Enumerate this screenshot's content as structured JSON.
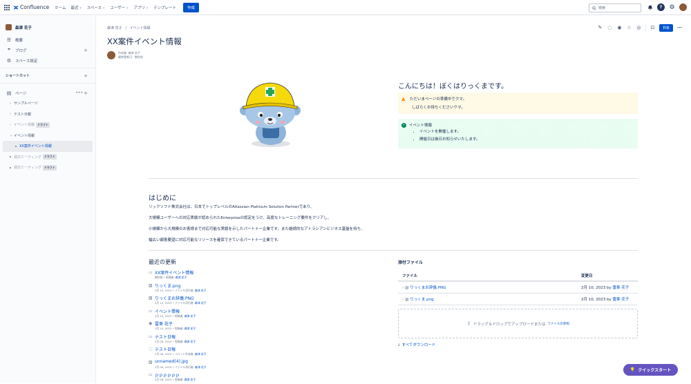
{
  "topnav": {
    "product": "Confluence",
    "items": [
      {
        "label": "ホーム",
        "chevron": false
      },
      {
        "label": "最近",
        "chevron": true
      },
      {
        "label": "スペース",
        "chevron": true
      },
      {
        "label": "ユーザー",
        "chevron": true
      },
      {
        "label": "アプリ",
        "chevron": true
      },
      {
        "label": "テンプレート",
        "chevron": false
      }
    ],
    "create_label": "作成",
    "search_placeholder": "検索"
  },
  "sidebar": {
    "space_name": "森津 花子",
    "nav": [
      {
        "label": "概要",
        "icon": "overview-icon"
      },
      {
        "label": "ブログ",
        "icon": "quote-icon"
      },
      {
        "label": "スペース設定",
        "icon": "gear-icon"
      }
    ],
    "shortcut_label": "ショートカット",
    "pages_label": "ページ",
    "tree": [
      {
        "label": "サンプルページ",
        "level": 1,
        "twisty": "›",
        "draft": "",
        "muted": false,
        "active": false
      },
      {
        "label": "テスト日報",
        "level": 1,
        "twisty": "›",
        "draft": "",
        "muted": false,
        "active": false
      },
      {
        "label": "イベント情報",
        "level": 1,
        "twisty": "›",
        "draft": "ドラフト",
        "muted": true,
        "active": false
      },
      {
        "label": "イベント情報",
        "level": 1,
        "twisty": "⌄",
        "draft": "",
        "muted": false,
        "active": false
      },
      {
        "label": "XX案件イベント情報",
        "level": 2,
        "twisty": "",
        "draft": "",
        "muted": false,
        "active": true
      },
      {
        "label": "週次ミーティング",
        "level": 1,
        "twisty": "",
        "draft": "ドラフト",
        "muted": true,
        "active": false
      },
      {
        "label": "週次ミーティング",
        "level": 1,
        "twisty": "",
        "draft": "ドラフト",
        "muted": true,
        "active": false
      }
    ]
  },
  "page": {
    "breadcrumb": [
      "森津 花子",
      "イベント情報"
    ],
    "share_label": "共有",
    "title": "XX案件イベント情報",
    "byline_author": "作成者: 森津 花子",
    "byline_updated": "最終更新日：数秒前"
  },
  "hello": {
    "heading": "こんにちは！ぼくはりっくまです。",
    "note_line1": "ただいまページの準備中でクマ。",
    "note_line2": "しばらくお待ちくださいクマ。",
    "info_title": "イベント情報",
    "info_bullets": [
      "イベントを開催します。",
      "開催日は後日お知らせいたします。"
    ]
  },
  "intro": {
    "heading": "はじめに",
    "lines": [
      "リックソフト株式会社は、日本でトップレベルのAtlassian Platinum Solution Partnerであり、",
      "大規模ユーザーへの対応実績が認められたEnterpriseの認定をうけ、高度なトレーニング要件をクリアし、",
      "小規模から大規模のお客様まで対応可能な実績を示したパートナー企業です。また継続的なアトラシアンビジネス基盤を持ち、",
      "幅広い顧客要望に対応可能なリソースを確保できているパートナー企業です。"
    ]
  },
  "recent": {
    "heading": "最近の更新",
    "items": [
      {
        "icon": "page-icon",
        "title": "XX案件イベント情報",
        "meta": "数秒前 • 投稿者: ",
        "by": "森津 花子"
      },
      {
        "icon": "image-icon",
        "title": "りっくま.png",
        "meta": "2月 10, 2023 • ファイル添付者: ",
        "by": "森津 花子"
      },
      {
        "icon": "image-icon",
        "title": "りっくまお辞儀.PNG",
        "meta": "2月 10, 2023 • ファイル添付者: ",
        "by": "森津 花子"
      },
      {
        "icon": "page-icon",
        "title": "イベント情報",
        "meta": "2月 10, 2023 • 投稿者: ",
        "by": "森津 花子"
      },
      {
        "icon": "user-icon",
        "title": "雷車 花子",
        "meta": "2月 10, 2023 • 投稿者: ",
        "by": "森津 花子"
      },
      {
        "icon": "page-icon",
        "title": "テスト日報",
        "meta": "2月 06, 2023 • 投稿者: ",
        "by": "森津 花子"
      },
      {
        "icon": "comment-icon",
        "title": "テスト日報",
        "meta": "2月 06, 2023 • コメント作成者: ",
        "by": "森津 花子"
      },
      {
        "icon": "image-icon",
        "title": "unnamed(4).jpg",
        "meta": "2月 06, 2023 • ファイル添付者: ",
        "by": "森津 花子"
      },
      {
        "icon": "page-icon",
        "title": "ｐｐｐｐｐｐ",
        "meta": "2月 06, 2023 • 投稿者: ",
        "by": "森津 花子"
      }
    ]
  },
  "attachments": {
    "heading": "添付ファイル",
    "col_file": "ファイル",
    "col_modified": "変更日",
    "rows": [
      {
        "file": "りっくまお辞儀.PNG",
        "date": "2月 10, 2023 by ",
        "by": "雷車 花子"
      },
      {
        "file": "りっくま.png",
        "date": "2月 10, 2023 by ",
        "by": "雷車 花子"
      }
    ],
    "drop_text": "ドラッグ＆ドロップでアップロードまたは",
    "drop_link": "ファイルの参照",
    "download_all": "すべてダウンロード"
  },
  "quickstart_label": "クイックスタート",
  "colors": {
    "brand": "#0052cc",
    "quickstart": "#6554c0",
    "note_bg": "#fffae6",
    "info_bg": "#e3fcef"
  }
}
